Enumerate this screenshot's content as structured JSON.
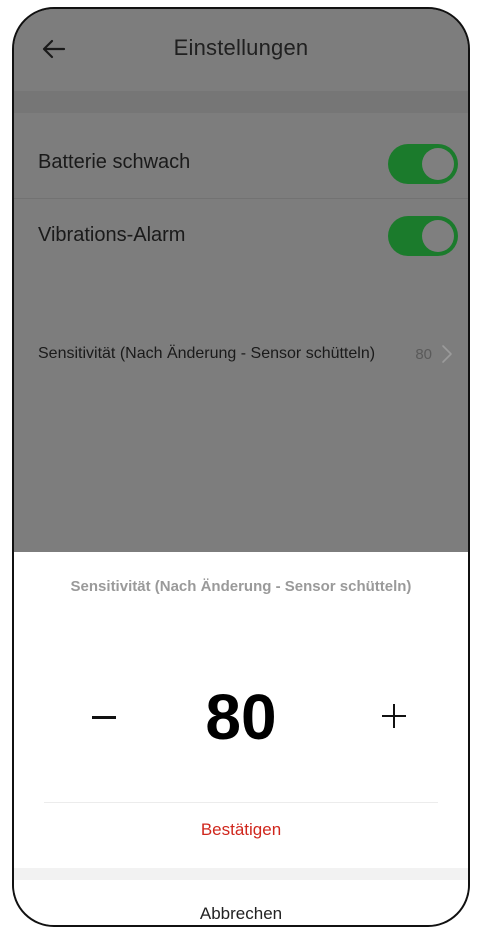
{
  "header": {
    "title": "Einstellungen",
    "back_icon": "arrow-left-icon"
  },
  "settings": {
    "rows": [
      {
        "label": "Batterie schwach",
        "toggle_on": true
      },
      {
        "label": "Vibrations-Alarm",
        "toggle_on": true
      }
    ],
    "sensitivity": {
      "label": "Sensitivität (Nach Änderung - Sensor schütteln)",
      "value": "80",
      "chevron_icon": "chevron-right-icon"
    }
  },
  "dialog": {
    "title": "Sensitivität (Nach Änderung - Sensor schütteln)",
    "value": "80",
    "decrement_icon": "minus-icon",
    "increment_icon": "plus-icon",
    "confirm_label": "Bestätigen",
    "cancel_label": "Abbrechen"
  },
  "colors": {
    "toggle_on": "#1b7b2c",
    "confirm_text": "#d0271d",
    "overlay": "#7d7d7d"
  }
}
